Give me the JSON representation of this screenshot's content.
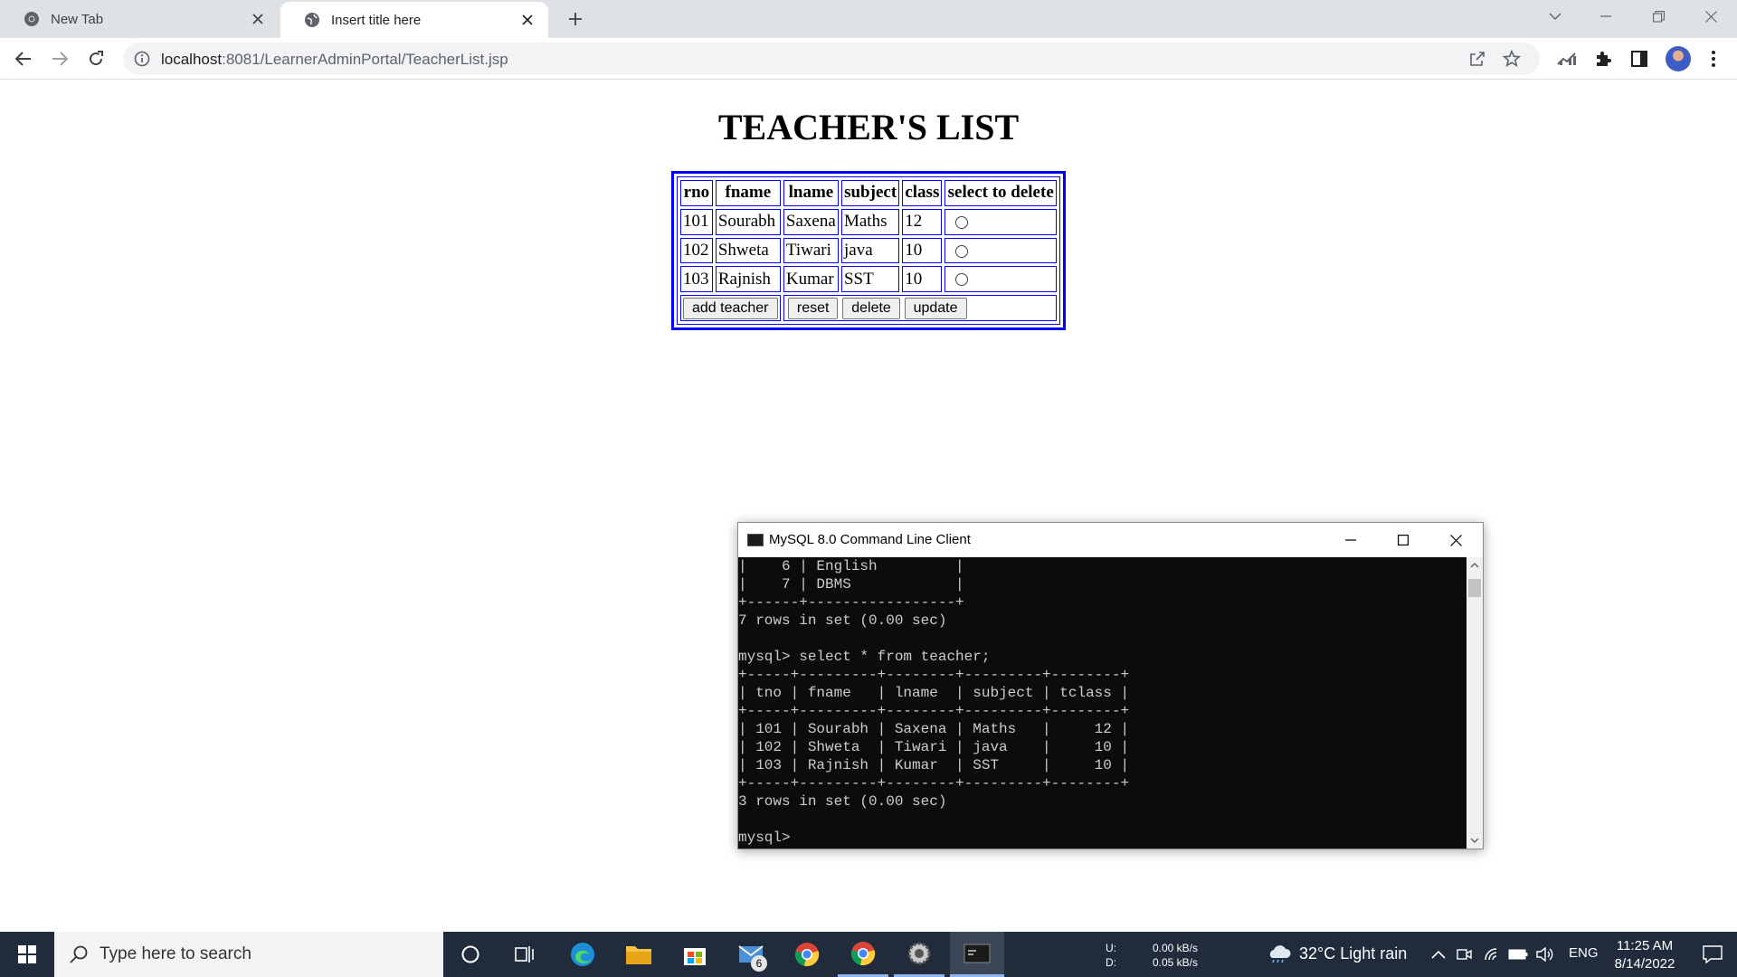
{
  "browser": {
    "tabs": [
      {
        "title": "New Tab",
        "active": false,
        "icon": "chrome-icon"
      },
      {
        "title": "Insert title here",
        "active": true,
        "icon": "globe-icon"
      }
    ],
    "url": {
      "host": "localhost",
      "path": ":8081/LearnerAdminPortal/TeacherList.jsp"
    }
  },
  "page": {
    "title": "TEACHER'S LIST",
    "table": {
      "headers": [
        "rno",
        "fname",
        "lname",
        "subject",
        "class",
        "select to delete"
      ],
      "rows": [
        {
          "rno": "101",
          "fname": "Sourabh",
          "lname": "Saxena",
          "subject": "Maths",
          "class": "12"
        },
        {
          "rno": "102",
          "fname": "Shweta",
          "lname": "Tiwari",
          "subject": "java",
          "class": "10"
        },
        {
          "rno": "103",
          "fname": "Rajnish",
          "lname": "Kumar",
          "subject": "SST",
          "class": "10"
        }
      ]
    },
    "buttons": {
      "add": "add teacher",
      "reset": "reset",
      "delete": "delete",
      "update": "update"
    }
  },
  "console": {
    "title": "MySQL 8.0 Command Line Client",
    "lines": [
      "|    6 | English         |",
      "|    7 | DBMS            |",
      "+------+-----------------+",
      "7 rows in set (0.00 sec)",
      "",
      "mysql> select * from teacher;",
      "+-----+---------+--------+---------+--------+",
      "| tno | fname   | lname  | subject | tclass |",
      "+-----+---------+--------+---------+--------+",
      "| 101 | Sourabh | Saxena | Maths   |     12 |",
      "| 102 | Shweta  | Tiwari | java    |     10 |",
      "| 103 | Rajnish | Kumar  | SST     |     10 |",
      "+-----+---------+--------+---------+--------+",
      "3 rows in set (0.00 sec)",
      "",
      "mysql>"
    ]
  },
  "taskbar": {
    "search_placeholder": "Type here to search",
    "mail_badge": "6",
    "net_labels": [
      "U:",
      "D:"
    ],
    "net_values": [
      "0.00 kB/s",
      "0.05 kB/s"
    ],
    "weather": "32°C  Light rain",
    "language": "ENG",
    "time": "11:25 AM",
    "date": "8/14/2022"
  },
  "colors": {
    "table_border": "#0000ff",
    "taskbar": "#202b3c",
    "console_bg": "#0c0c0c"
  }
}
